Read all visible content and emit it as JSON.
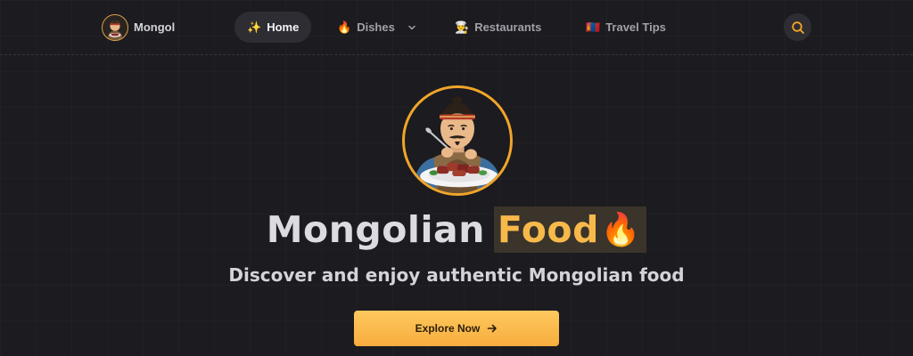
{
  "brand": {
    "name": "Mongol",
    "logo_icon": "mongol-chef-logo"
  },
  "nav": {
    "items": [
      {
        "emoji": "✨",
        "label": "Home",
        "active": true
      },
      {
        "emoji": "🔥",
        "label": "Dishes",
        "has_dropdown": true
      },
      {
        "emoji": "👨‍🍳",
        "label": "Restaurants"
      },
      {
        "emoji": "🇲🇳",
        "label": "Travel Tips"
      }
    ],
    "search_icon": "search-icon"
  },
  "hero": {
    "avatar_icon": "mongol-chef-eating-icon",
    "title_main": "Mongolian",
    "title_highlight": "Food",
    "title_emoji": "🔥",
    "subtitle": "Discover and enjoy authentic Mongolian food",
    "cta_label": "Explore Now",
    "cta_icon": "arrow-right-icon"
  },
  "colors": {
    "background": "#1c1b1f",
    "accent": "#f7b94a",
    "button_gradient_top": "#ffc85e",
    "button_gradient_bottom": "#f7ad3d"
  }
}
